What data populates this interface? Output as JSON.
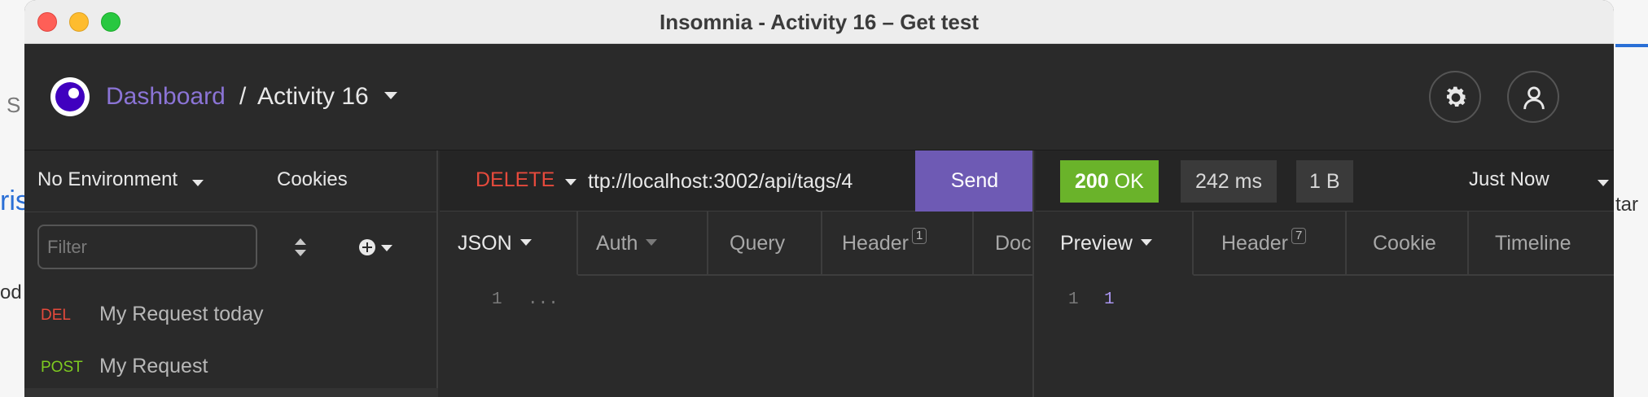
{
  "window": {
    "title": "Insomnia - Activity 16 – Get test"
  },
  "background": {
    "frag_left_1": "S",
    "frag_left_2": "ris",
    "frag_left_3": "od",
    "frag_right": "tar"
  },
  "header": {
    "breadcrumb_root": "Dashboard",
    "separator": "/",
    "workspace": "Activity 16",
    "settings_icon": "gear-icon",
    "account_icon": "user-icon"
  },
  "sidebar": {
    "environment": "No Environment",
    "cookies_label": "Cookies",
    "filter_placeholder": "Filter",
    "requests": [
      {
        "method": "DEL",
        "name": "My Request today"
      },
      {
        "method": "POST",
        "name": "My Request"
      }
    ]
  },
  "request": {
    "method": "DELETE",
    "url": "ttp://localhost:3002/api/tags/4",
    "send_label": "Send",
    "tabs": [
      {
        "label": "JSON"
      },
      {
        "label": "Auth"
      },
      {
        "label": "Query"
      },
      {
        "label": "Header",
        "count": "1"
      },
      {
        "label": "Doc"
      }
    ],
    "editor": {
      "line_number": "1",
      "content": "..."
    }
  },
  "response": {
    "status_code": "200",
    "status_text": "OK",
    "time": "242 ms",
    "size": "1 B",
    "history": "Just Now",
    "tabs": [
      {
        "label": "Preview"
      },
      {
        "label": "Header",
        "count": "7"
      },
      {
        "label": "Cookie"
      },
      {
        "label": "Timeline"
      }
    ],
    "body": {
      "line_number": "1",
      "content": "1"
    }
  },
  "colors": {
    "accent": "#6e5ab4",
    "delete": "#e64a3c",
    "post": "#7ecb20",
    "success": "#6ab32a"
  }
}
